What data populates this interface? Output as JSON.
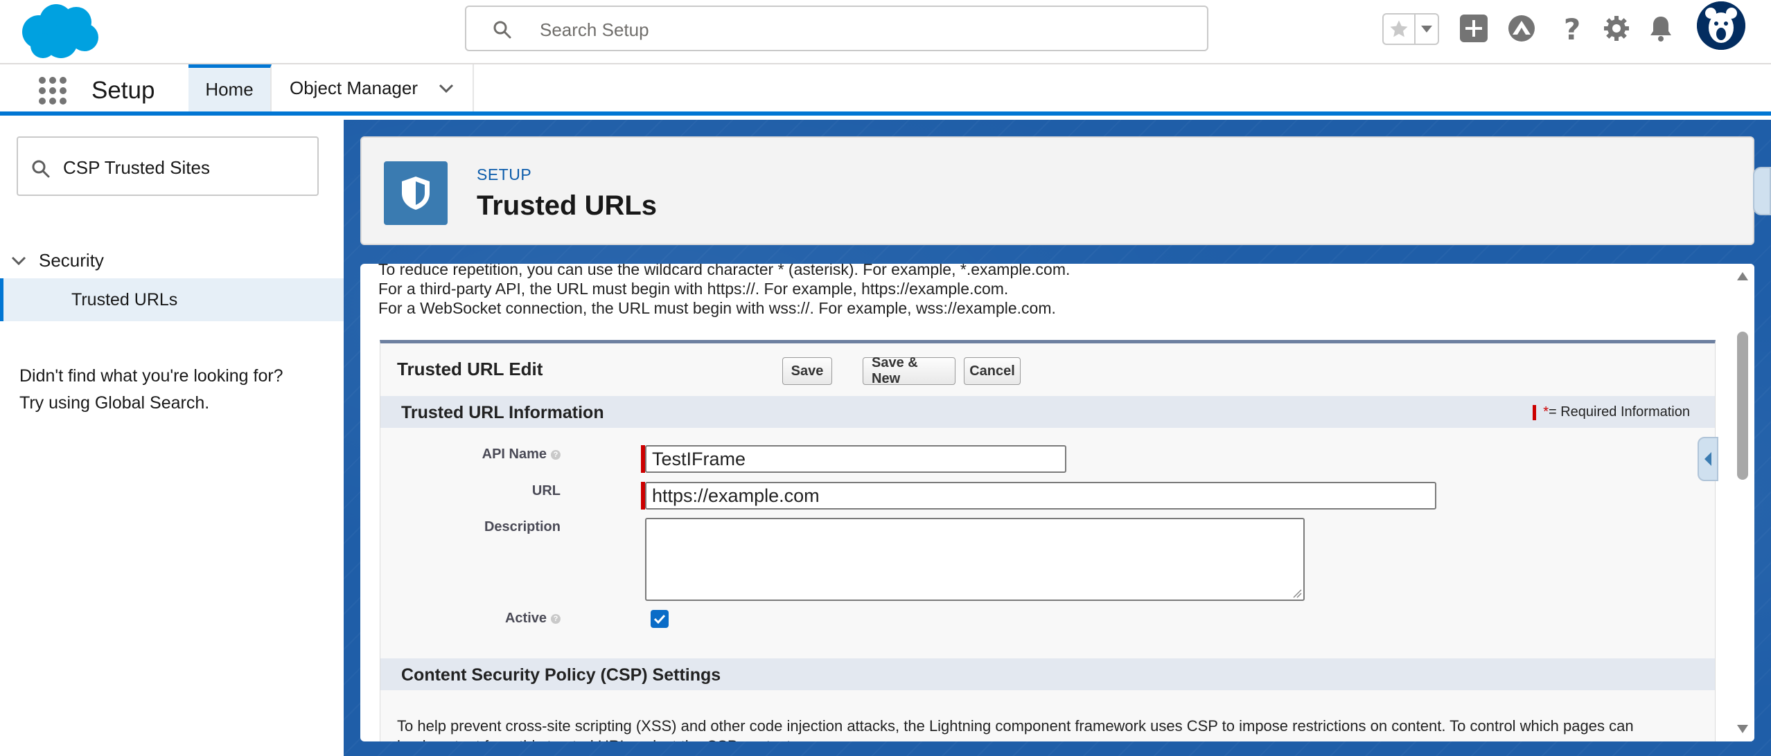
{
  "header": {
    "search_placeholder": "Search Setup",
    "icons": [
      "salesforce-cloud-logo",
      "search-icon",
      "favorites-star-icon",
      "favorites-menu-icon",
      "add-icon",
      "trailhead-icon",
      "help-icon",
      "gear-icon",
      "bell-icon",
      "avatar"
    ]
  },
  "context_bar": {
    "app_name": "Setup",
    "tabs": [
      {
        "label": "Home"
      },
      {
        "label": "Object Manager"
      }
    ]
  },
  "sidebar": {
    "quick_find_value": "CSP Trusted Sites",
    "tree_node": "Security",
    "tree_leaf": "Trusted URLs",
    "not_found_line1": "Didn't find what you're looking for?",
    "not_found_line2": "Try using Global Search."
  },
  "page_header": {
    "eyebrow": "SETUP",
    "title": "Trusted URLs"
  },
  "help_text": [
    "To reduce repetition, you can use the wildcard character * (asterisk). For example, *.example.com.",
    "For a third-party API, the URL must begin with https://. For example, https://example.com.",
    "For a WebSocket connection, the URL must begin with wss://. For example, wss://example.com."
  ],
  "form": {
    "title": "Trusted URL Edit",
    "buttons": {
      "save": "Save",
      "save_new": "Save & New",
      "cancel": "Cancel"
    },
    "section_info": "Trusted URL Information",
    "required_legend": "= Required Information",
    "fields": {
      "api_name_label": "API Name",
      "api_name_value": "TestIFrame",
      "url_label": "URL",
      "url_value": "https://example.com",
      "description_label": "Description",
      "description_value": "",
      "active_label": "Active",
      "active_checked": true
    },
    "section_csp": "Content Security Policy (CSP) Settings",
    "csp_text_line1": "To help prevent cross-site scripting (XSS) and other code injection attacks, the Lightning component framework uses CSP to impose restrictions on content. To control which pages can",
    "csp_text_line2": "load content from this trusted URL, select the CSP context."
  },
  "colors": {
    "brand_blue": "#0176d3",
    "logo_blue": "#00a1e0",
    "main_bg": "#1f5ea8",
    "required_red": "#cc0000",
    "checkbox_blue": "#0a6cc7"
  }
}
